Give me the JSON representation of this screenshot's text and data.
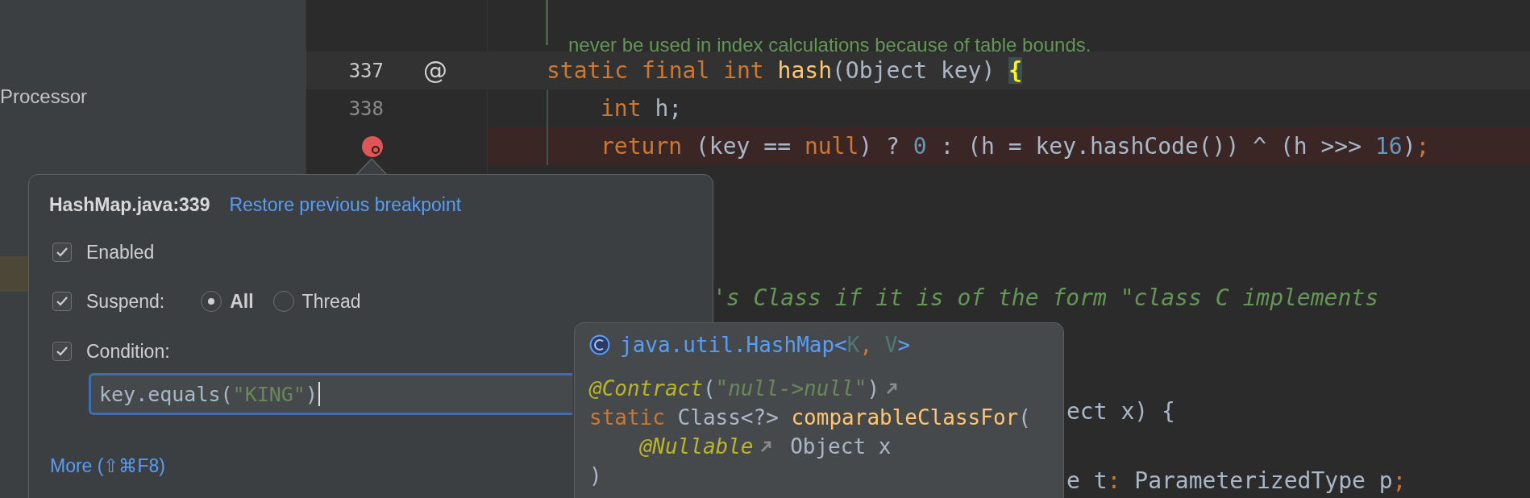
{
  "sidebar": {
    "items": [
      {
        "label": "Processor",
        "selected": false
      },
      {
        "selected": true
      }
    ]
  },
  "editor": {
    "doc_comment": "never be used in index calculations because of table bounds.",
    "lines": [
      {
        "number": "337",
        "current": true,
        "gutter_mark": "@",
        "breakpoint": false,
        "tokens": [
          "static final int ",
          "hash",
          "(Object key) ",
          "{"
        ]
      },
      {
        "number": "338",
        "current": false,
        "breakpoint": false,
        "tokens": [
          "int ",
          "h;"
        ]
      },
      {
        "current": false,
        "breakpoint": true,
        "tokens": [
          "return ",
          "(key == ",
          "null",
          ") ? ",
          "0",
          " : (h = key.hashCode()) ^ (h >>> ",
          "16",
          ")",
          ";"
        ]
      }
    ],
    "fragments": [
      {
        "tokens": [
          "'s Class if it is of the form \"class C implements"
        ]
      },
      {
        "tokens": [
          "ect x) {"
        ]
      },
      {
        "tokens": [
          "e t",
          ":",
          " ParameterizedType p",
          ";"
        ]
      }
    ]
  },
  "breakpoint_popup": {
    "title": "HashMap.java:339",
    "restore_link": "Restore previous breakpoint",
    "enabled": {
      "label": "Enabled",
      "checked": true
    },
    "suspend": {
      "label": "Suspend:",
      "checked": true,
      "options": [
        {
          "label": "All",
          "selected": true
        },
        {
          "label": "Thread",
          "selected": false
        }
      ]
    },
    "condition": {
      "label": "Condition:",
      "checked": true,
      "tokens": [
        "key.equals(",
        "\"KING\"",
        ")"
      ]
    },
    "more_link": "More (⇧⌘F8)"
  },
  "quick_doc": {
    "header_tokens": [
      "java.util.HashMap<",
      "K",
      ", ",
      "V",
      ">"
    ],
    "lines": [
      {
        "tokens": [
          "@Contract",
          "(",
          "\"null->null\"",
          ")"
        ]
      },
      {
        "tokens": [
          "static ",
          "Class<?> ",
          "comparableClassFor",
          "("
        ]
      },
      {
        "tokens": [
          "@Nullable",
          " Object x"
        ]
      },
      {
        "tokens": [
          ")"
        ]
      }
    ]
  }
}
